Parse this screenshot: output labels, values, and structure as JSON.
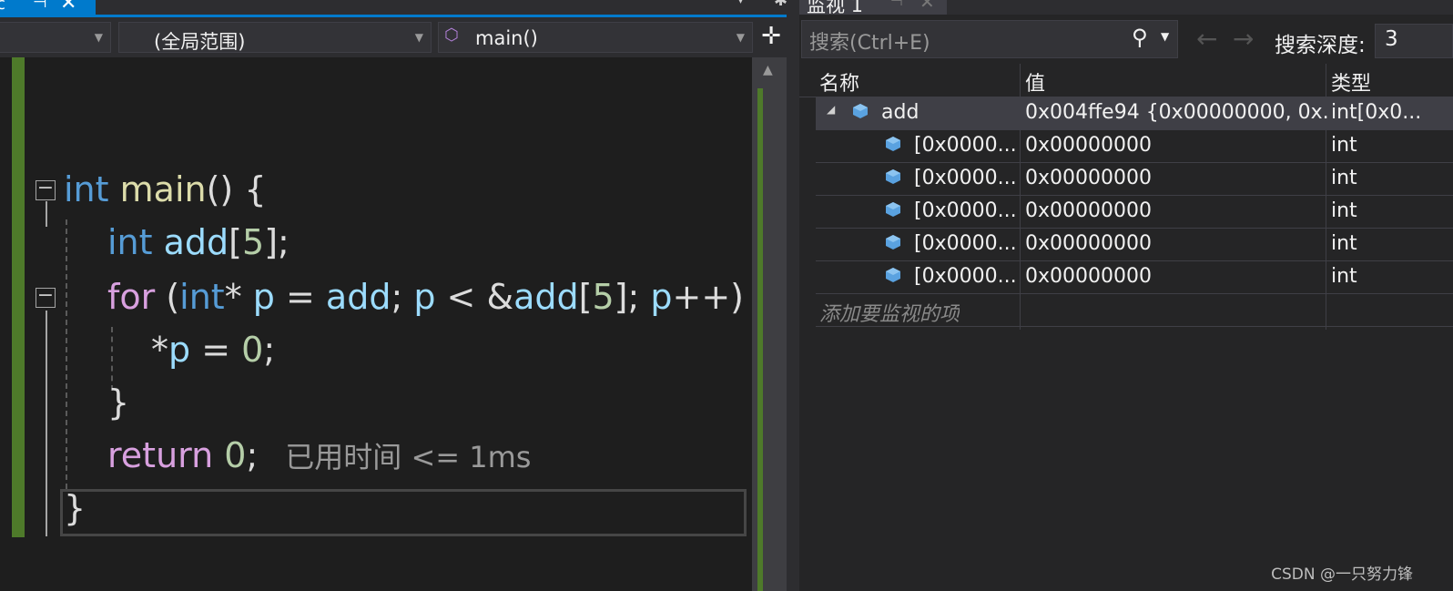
{
  "editor": {
    "tab_partial_text": "c",
    "scope_combo": "(全局范围)",
    "function_combo": "main()",
    "code_lines": {
      "l1_kw": "int",
      "l1_fn": "main",
      "l1_rest": "() {",
      "l2_kw": "int",
      "l2_var": "add",
      "l2_open": "[",
      "l2_num": "5",
      "l2_close": "];",
      "l3_kw": "for",
      "l3_a": " (",
      "l3_int": "int",
      "l3_b": "* ",
      "l3_p": "p",
      "l3_c": " = ",
      "l3_add": "add",
      "l3_d": "; ",
      "l3_p2": "p",
      "l3_e": " < &",
      "l3_add2": "add",
      "l3_f": "[",
      "l3_num": "5",
      "l3_g": "]; ",
      "l3_p3": "p",
      "l3_h": "++) {",
      "l4_a": "*",
      "l4_p": "p",
      "l4_b": " = ",
      "l4_num": "0",
      "l4_c": ";",
      "l5": "}",
      "l6_kw": "return",
      "l6_sp": " ",
      "l6_num": "0",
      "l6_end": ";",
      "l6_perf": "已用时间 <= 1ms",
      "l7": "}"
    }
  },
  "watch": {
    "tab_title": "监视 1",
    "search_placeholder": "搜索(Ctrl+E)",
    "depth_label": "搜索深度:",
    "depth_value": "3",
    "columns": [
      "名称",
      "值",
      "类型"
    ],
    "rows": [
      {
        "name": "add",
        "value": "0x004ffe94 {0x00000000, 0x...",
        "type": "int[0x0..."
      },
      {
        "name": "[0x0000...",
        "value": "0x00000000",
        "type": "int"
      },
      {
        "name": "[0x0000...",
        "value": "0x00000000",
        "type": "int"
      },
      {
        "name": "[0x0000...",
        "value": "0x00000000",
        "type": "int"
      },
      {
        "name": "[0x0000...",
        "value": "0x00000000",
        "type": "int"
      },
      {
        "name": "[0x0000...",
        "value": "0x00000000",
        "type": "int"
      }
    ],
    "add_item_hint": "添加要监视的项"
  },
  "watermark": "CSDN @一只努力锋",
  "colors": {
    "accent": "#007acc",
    "keyword": "#569cd6",
    "control": "#d8a0df",
    "function": "#dcdcaa",
    "variable": "#9cdcfe",
    "number": "#b5cea8",
    "margin_green": "#4e7a2a"
  }
}
